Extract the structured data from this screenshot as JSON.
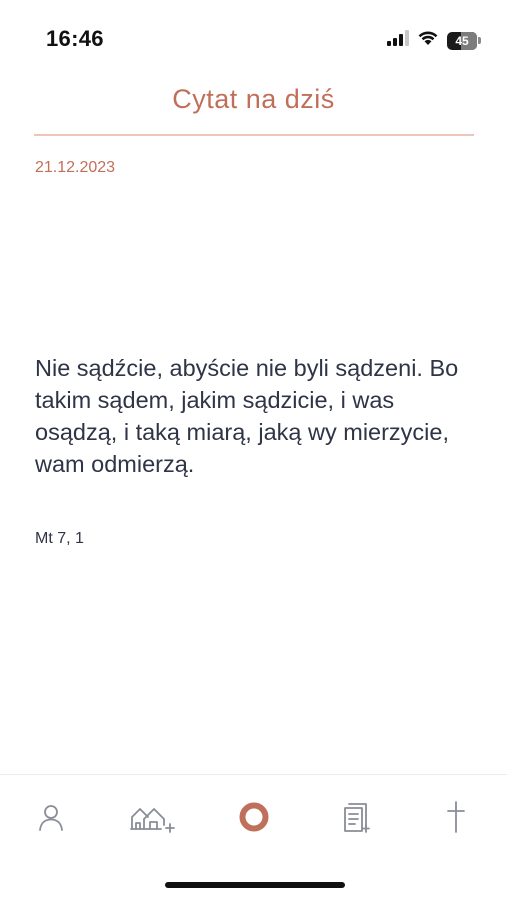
{
  "status_bar": {
    "time": "16:46",
    "battery_level": "45",
    "icons": [
      "signal-icon",
      "wifi-icon",
      "battery-icon"
    ]
  },
  "header": {
    "title": "Cytat na dziś"
  },
  "quote": {
    "date": "21.12.2023",
    "text": "Nie sądźcie, abyście nie byli sądzeni. Bo takim sądem, jakim sądzicie, i was osądzą, i taką miarą, jaką wy mierzycie, wam odmierzą.",
    "reference": "Mt 7, 1"
  },
  "tab_bar": {
    "items": [
      {
        "icon": "person-icon",
        "active": false
      },
      {
        "icon": "houses-icon",
        "active": false
      },
      {
        "icon": "ring-icon",
        "active": true
      },
      {
        "icon": "document-icon",
        "active": false
      },
      {
        "icon": "cross-icon",
        "active": false
      }
    ]
  },
  "colors": {
    "accent": "#c0705a",
    "text": "#2f3446",
    "divider": "#ecc6b8",
    "inactive_icon": "#8a8d97"
  }
}
